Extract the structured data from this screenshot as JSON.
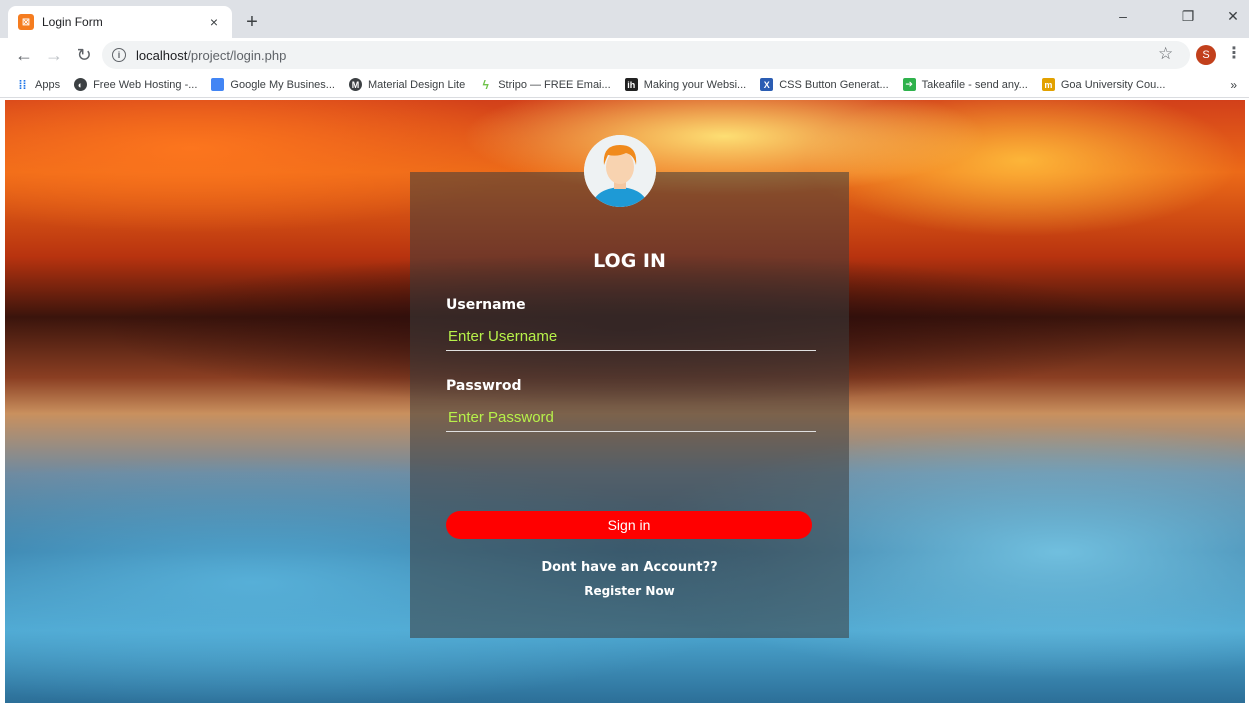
{
  "browser": {
    "tab_title": "Login Form",
    "tab_close": "×",
    "new_tab": "+",
    "url_host": "localhost",
    "url_path": "/project/login.php",
    "profile_initial": "S",
    "window_controls": {
      "minimize": "–",
      "restore": "❐",
      "close": "✕"
    },
    "bookmarks": [
      {
        "label": "Apps",
        "icon": "apps-grid-icon",
        "color": "#1a73e8"
      },
      {
        "label": "Free Web Hosting -...",
        "icon": "globe-icon",
        "color": "#3c4043"
      },
      {
        "label": "Google My Busines...",
        "icon": "google-my-business-icon",
        "color": "#4285f4"
      },
      {
        "label": "Material Design Lite",
        "icon": "mdl-icon",
        "color": "#3c4043"
      },
      {
        "label": "Stripo — FREE Emai...",
        "icon": "stripo-icon",
        "color": "#6fc24a"
      },
      {
        "label": "Making your Websi...",
        "icon": "ih-icon",
        "color": "#222222"
      },
      {
        "label": "CSS Button Generat...",
        "icon": "css-x-icon",
        "color": "#2b5db3"
      },
      {
        "label": "Takeafile - send any...",
        "icon": "takeafile-icon",
        "color": "#2fb24c"
      },
      {
        "label": "Goa University Cou...",
        "icon": "goa-university-icon",
        "color": "#e2a100"
      }
    ],
    "bookmarks_more": "»"
  },
  "login": {
    "title": "LOG IN",
    "username_label": "Username",
    "username_placeholder": "Enter Username",
    "password_label": "Passwrod",
    "password_placeholder": "Enter Password",
    "signin_label": "Sign in",
    "no_account_text": "Dont have an Account??",
    "register_text": "Register Now"
  },
  "colors": {
    "accent_button": "#ff0000",
    "placeholder": "#b7f24a",
    "card_overlay": "rgba(60,60,60,0.55)"
  }
}
